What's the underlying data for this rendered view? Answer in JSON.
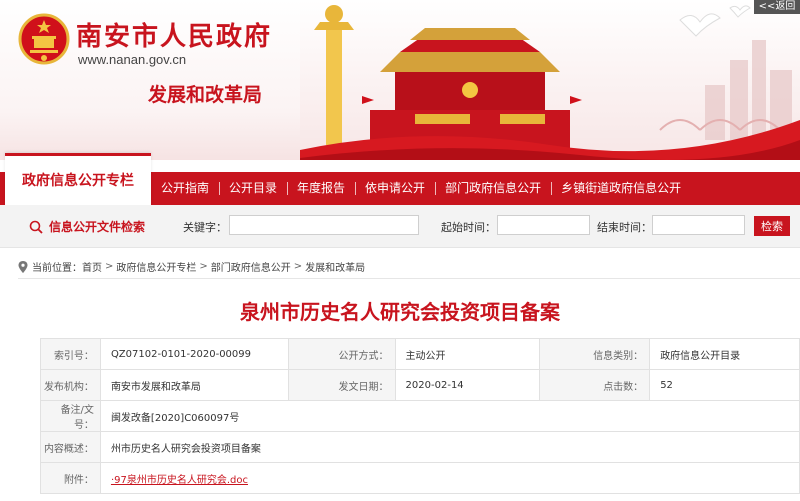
{
  "header": {
    "site_title": "南安市人民政府",
    "site_url": "www.nanan.gov.cn",
    "dept_name": "发展和改革局",
    "back_link": "<<返回"
  },
  "nav": {
    "active_tab": "政府信息公开专栏",
    "items": [
      "公开指南",
      "公开目录",
      "年度报告",
      "依申请公开",
      "部门政府信息公开",
      "乡镇街道政府信息公开"
    ]
  },
  "search": {
    "title": "信息公开文件检索",
    "keyword_label": "关键字：",
    "start_label": "起始时间：",
    "end_label": "结束时间：",
    "keyword_value": "",
    "start_value": "",
    "end_value": "",
    "button": "检索"
  },
  "breadcrumb": {
    "prefix": "当前位置：",
    "items": [
      "首页",
      "政府信息公开专栏",
      "部门政府信息公开",
      "发展和改革局"
    ],
    "sep": ">"
  },
  "document": {
    "title": "泉州市历史名人研究会投资项目备案"
  },
  "info": {
    "index_label": "索引号：",
    "index_value": "QZ07102-0101-2020-00099",
    "method_label": "公开方式：",
    "method_value": "主动公开",
    "category_label": "信息类别：",
    "category_value": "政府信息公开目录",
    "publisher_label": "发布机构：",
    "publisher_value": "南安市发展和改革局",
    "date_label": "发文日期：",
    "date_value": "2020-02-14",
    "clicks_label": "点击数：",
    "clicks_value": "52",
    "docno_label": "备注/文号：",
    "docno_value": "闽发改备[2020]C060097号",
    "summary_label": "内容概述：",
    "summary_value": "州市历史名人研究会投资项目备案",
    "attach_label": "附件：",
    "attach_value": "·97泉州市历史名人研究会.doc"
  },
  "colors": {
    "brand_red": "#c8141e",
    "gold": "#e8b63a"
  }
}
